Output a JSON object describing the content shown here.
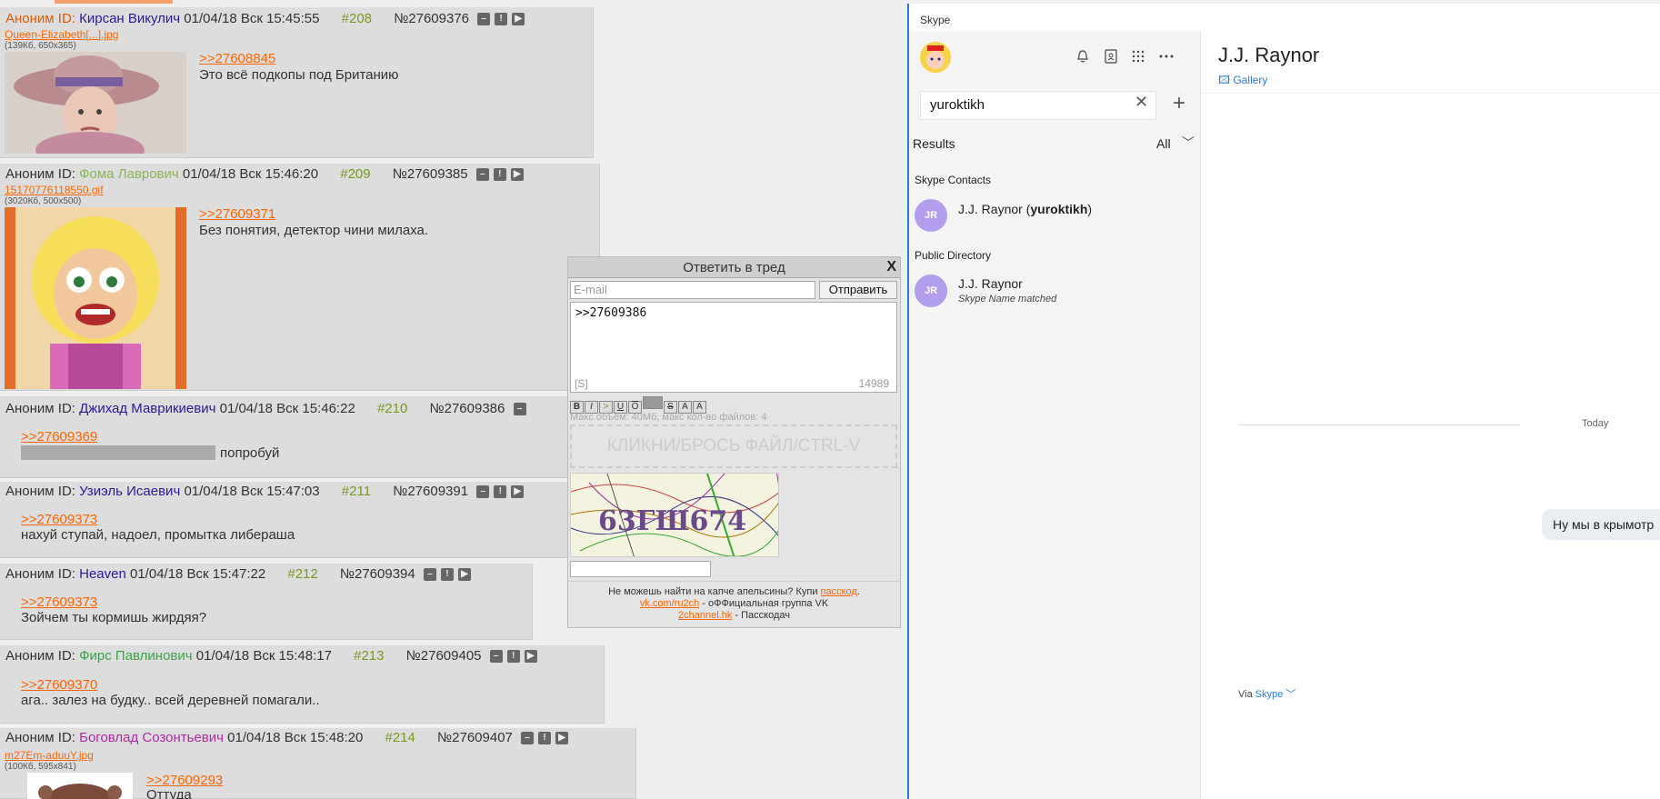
{
  "posts": [
    {
      "anon": "Аноним ID:",
      "name": "Кирсан Викулич",
      "date": "01/04/18 Вск 15:45:55",
      "num": "#208",
      "id": "№27609376",
      "file": "Queen-Elizabeth[...].jpg",
      "file_meta": "(139Кб, 650x365)",
      "reply": ">>27608845",
      "text": "Это всё подкопы под Британию"
    },
    {
      "anon": "Аноним ID:",
      "name": "Фома Лаврович",
      "date": "01/04/18 Вск 15:46:20",
      "num": "#209",
      "id": "№27609385",
      "file": "15170776118550.gif",
      "file_meta": "(3020Кб, 500x500)",
      "reply": ">>27609371",
      "text": "Без понятия, детектор чини милаха."
    },
    {
      "anon": "Аноним ID:",
      "name": "Джихад Маврикиевич",
      "date": "01/04/18 Вск 15:46:22",
      "num": "#210",
      "id": "№27609386",
      "reply": ">>27609369",
      "text": "попробуй"
    },
    {
      "anon": "Аноним ID:",
      "name": "Узиэль Исаевич",
      "date": "01/04/18 Вск 15:47:03",
      "num": "#211",
      "id": "№27609391",
      "reply": ">>27609373",
      "text": "нахуй ступай, надоел, промытка либераша"
    },
    {
      "anon": "Аноним ID:",
      "name": "Heaven",
      "date": "01/04/18 Вск 15:47:22",
      "num": "#212",
      "id": "№27609394",
      "reply": ">>27609373",
      "text": "Зойчем ты кормишь жирдяя?"
    },
    {
      "anon": "Аноним ID:",
      "name": "Фирс Павлинович",
      "date": "01/04/18 Вск 15:48:17",
      "num": "#213",
      "id": "№27609405",
      "reply": ">>27609370",
      "text": "ага.. залез на будку.. всей деревней помагали.."
    },
    {
      "anon": "Аноним ID:",
      "name": "Боговлад Созонтьевич",
      "date": "01/04/18 Вск 15:48:20",
      "num": "#214",
      "id": "№27609407",
      "file": "m27Em-aduuY.jpg",
      "file_meta": "(100Кб, 595x841)",
      "reply": ">>27609293",
      "text": "Оттуда"
    }
  ],
  "form": {
    "title": "Ответить в тред",
    "close": "X",
    "email_placeholder": "E-mail",
    "send": "Отправить",
    "text": ">>27609386",
    "s_tag": "[S]",
    "counter": "14989",
    "markup": [
      "B",
      "I",
      ">",
      "U",
      "O",
      "",
      "S",
      "A",
      "A"
    ],
    "max_files": "Макс объем: 40Мб, макс кол-во файлов: 4",
    "drop": "КЛИКНИ/БРОСЬ ФАЙЛ/CTRL-V",
    "captcha_text": "63ГШ674",
    "foot1_pre": "Не можешь найти на капче апельсины? Купи ",
    "foot1_link": "пасскод",
    "foot1_post": ".",
    "foot2_link": "vk.com/ru2ch",
    "foot2_post": " - оФФициальная группа VK",
    "foot3_link": "2channel.hk",
    "foot3_post": " - Пасскодач"
  },
  "skype": {
    "window_title": "Skype",
    "search_value": "yuroktikh",
    "results_label": "Results",
    "filter_value": "All",
    "contacts_section": "Skype Contacts",
    "directory_section": "Public Directory",
    "contact": {
      "initials": "JR",
      "name": "J.J. Raynor",
      "handle": "yuroktikh"
    },
    "directory": {
      "initials": "JR",
      "name": "J.J. Raynor",
      "sub": "Skype Name matched"
    },
    "chat_title": "J.J. Raynor",
    "gallery": "Gallery",
    "today": "Today",
    "bubble": "Ну мы в крымотр",
    "via_pre": "Via",
    "via_link": "Skype"
  }
}
